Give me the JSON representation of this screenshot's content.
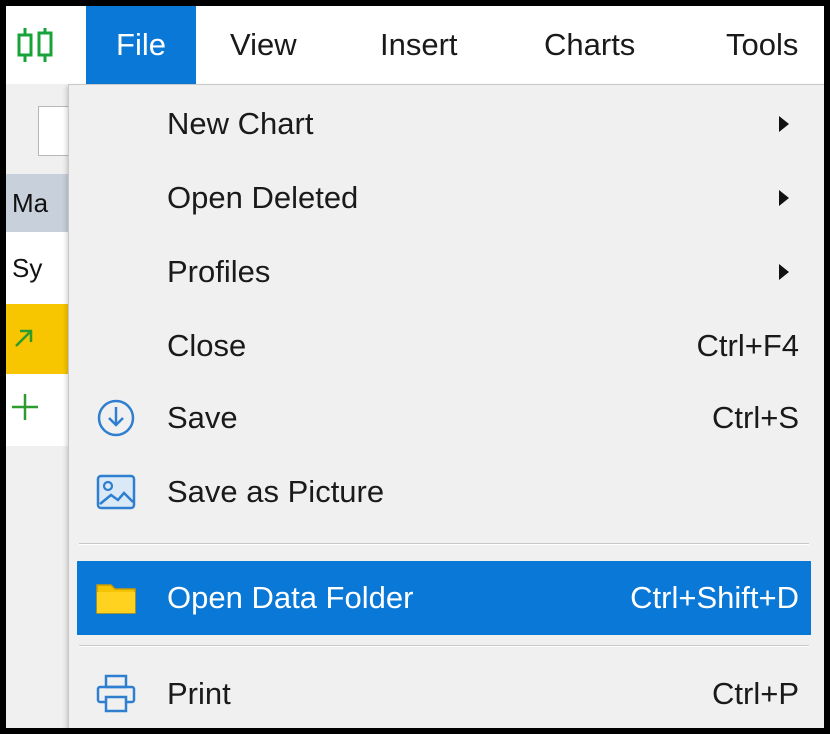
{
  "menubar": {
    "app_icon": "candlestick-chart-icon",
    "items": [
      {
        "label": "File",
        "active": true
      },
      {
        "label": "View"
      },
      {
        "label": "Insert"
      },
      {
        "label": "Charts"
      },
      {
        "label": "Tools"
      }
    ]
  },
  "background": {
    "market_watch_header": "Ma",
    "symbol_row": "Sy",
    "row_arrow_icon": "arrow-up-right-icon",
    "row_plus_icon": "plus-icon"
  },
  "file_menu": {
    "items": [
      {
        "label": "New Chart",
        "submenu": true
      },
      {
        "label": "Open Deleted",
        "submenu": true
      },
      {
        "label": "Profiles",
        "submenu": true
      },
      {
        "label": "Close",
        "shortcut": "Ctrl+F4"
      },
      {
        "label": "Save",
        "shortcut": "Ctrl+S",
        "icon": "save-icon"
      },
      {
        "label": "Save as Picture",
        "icon": "picture-icon"
      },
      {
        "label": "Open Data Folder",
        "shortcut": "Ctrl+Shift+D",
        "icon": "folder-icon",
        "highlighted": true
      },
      {
        "label": "Print",
        "shortcut": "Ctrl+P",
        "icon": "printer-icon"
      }
    ]
  },
  "colors": {
    "accent": "#0a78d6",
    "app_icon_green": "#18a33a",
    "highlight_row_yellow": "#f7c600",
    "folder_yellow": "#f5c400"
  }
}
